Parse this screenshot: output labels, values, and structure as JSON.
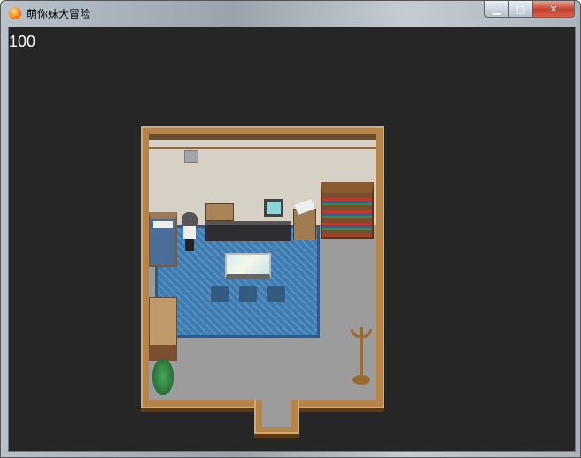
{
  "window": {
    "title": "萌你妹大冒险",
    "buttons": {
      "minimize": "▁",
      "maximize": "□",
      "close": "✕"
    }
  },
  "hud": {
    "score": "100"
  },
  "colors": {
    "background": "#262626",
    "wood": "#b5844a",
    "wall": "#d6d1c4",
    "floor": "#9a9a9a",
    "rug": "#3c74a6"
  }
}
